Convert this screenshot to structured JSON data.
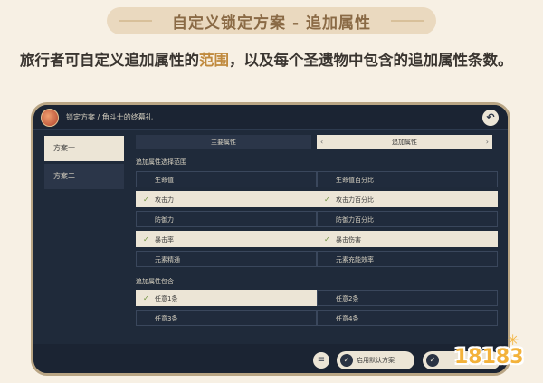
{
  "banner": {
    "title": "自定义锁定方案 - 追加属性"
  },
  "intro": {
    "before": "旅行者可自定义追加属性的",
    "highlight": "范围",
    "after": "，以及每个圣遗物中包含的追加属性条数。"
  },
  "window": {
    "breadcrumb": "锁定方案 / 角斗士的终幕礼",
    "back_icon": "back-icon",
    "schemes": [
      {
        "label": "方案一",
        "active": true
      },
      {
        "label": "方案二",
        "active": false
      }
    ],
    "tabs": [
      {
        "label": "主要属性",
        "active": false
      },
      {
        "label": "追加属性",
        "active": true
      }
    ],
    "range_section_label": "追加属性选择范围",
    "range_options": [
      [
        {
          "label": "生命值",
          "selected": false
        },
        {
          "label": "生命值百分比",
          "selected": false
        }
      ],
      [
        {
          "label": "攻击力",
          "selected": true
        },
        {
          "label": "攻击力百分比",
          "selected": true
        }
      ],
      [
        {
          "label": "防御力",
          "selected": false
        },
        {
          "label": "防御力百分比",
          "selected": false
        }
      ],
      [
        {
          "label": "暴击率",
          "selected": true
        },
        {
          "label": "暴击伤害",
          "selected": true
        }
      ],
      [
        {
          "label": "元素精通",
          "selected": false
        },
        {
          "label": "元素充能效率",
          "selected": false
        }
      ]
    ],
    "count_section_label": "追加属性包含",
    "count_options": [
      [
        {
          "label": "任意1条",
          "selected": true
        },
        {
          "label": "任意2条",
          "selected": false
        }
      ],
      [
        {
          "label": "任意3条",
          "selected": false
        },
        {
          "label": "任意4条",
          "selected": false
        }
      ]
    ],
    "bottom": {
      "icon_button": "list-icon",
      "default_button": "启用默认方案",
      "confirm_button": ""
    }
  },
  "watermark": {
    "text": "18183"
  },
  "colors": {
    "banner_text": "#8a6a45",
    "highlight": "#c08a3e",
    "window_bg": "#1f2a3a",
    "cell_selected": "#ece5d6",
    "check": "#6d8f3a"
  }
}
